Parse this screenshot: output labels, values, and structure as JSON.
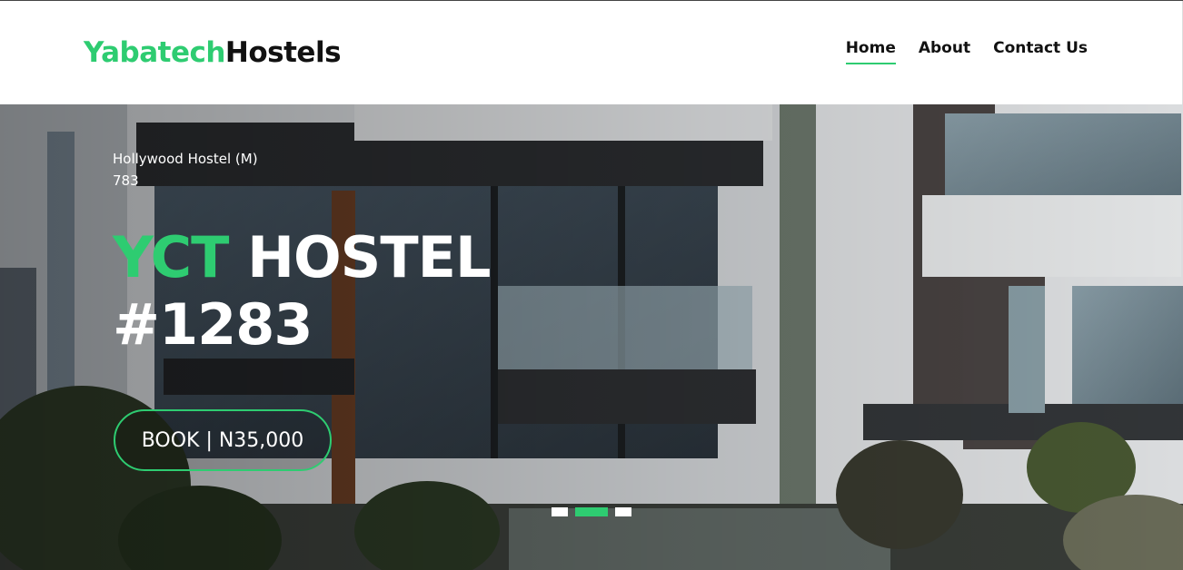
{
  "brand": {
    "part1": "Yabatech",
    "part2": "Hostels"
  },
  "nav": {
    "items": [
      {
        "label": "Home",
        "active": true
      },
      {
        "label": "About",
        "active": false
      },
      {
        "label": "Contact Us",
        "active": false
      }
    ]
  },
  "hero": {
    "hostel_name": "Hollywood Hostel (M)",
    "hostel_number": "783",
    "title_highlight": "YCT",
    "title_rest": "HOSTEL",
    "title_line2": "#1283",
    "book_label": "BOOK | N35,000"
  },
  "carousel": {
    "slides": 3,
    "active_index": 1
  },
  "colors": {
    "accent": "#2ecc71",
    "text_dark": "#111111",
    "white": "#ffffff"
  }
}
